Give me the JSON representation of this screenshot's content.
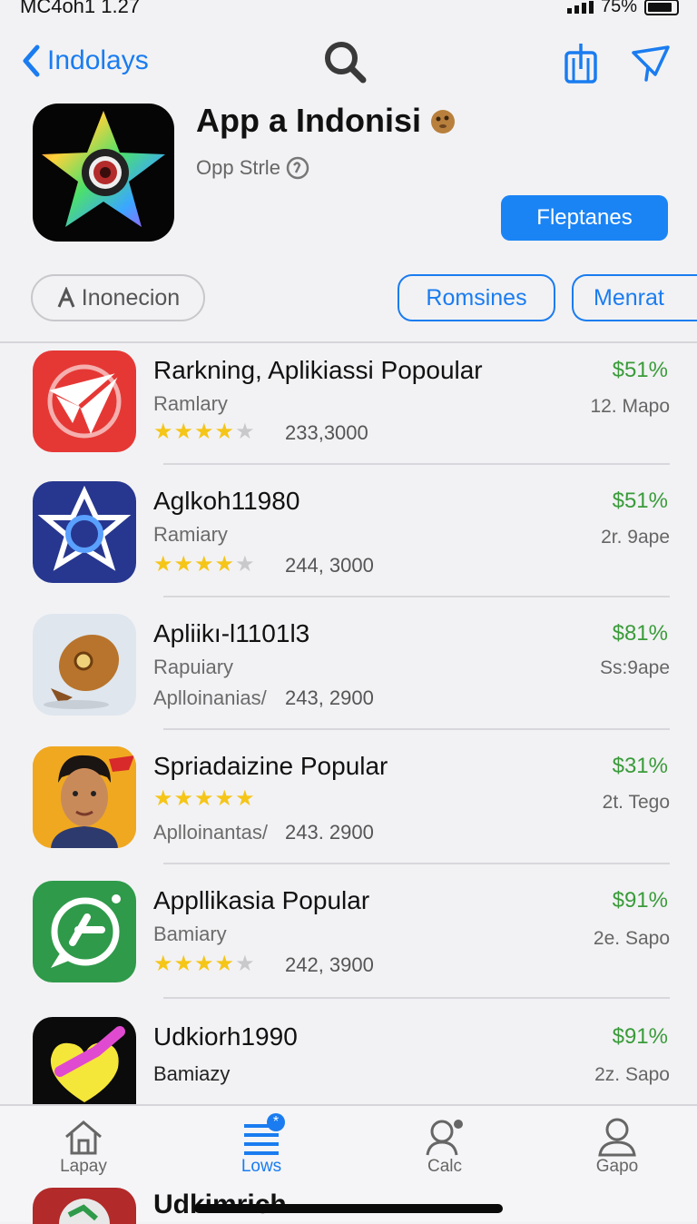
{
  "status": {
    "time": "MC4oh1  1.27",
    "battery": "75%"
  },
  "nav": {
    "back_label": "Indolays"
  },
  "app": {
    "title": "App a Indonisi",
    "subtitle": "Opp Strle",
    "get_label": "Fleptanes"
  },
  "pills": {
    "grey": "Inonecion",
    "blue1": "Romsines",
    "blue2": "Menrat"
  },
  "rows": [
    {
      "name": "Rarkning, Aplikiassi Popoular",
      "category": "Ramlary",
      "rating": 4,
      "count": "233,3000",
      "price": "$51%",
      "size": "12. Mapo"
    },
    {
      "name": "Aglkoh11980",
      "category": "Ramiary",
      "rating": 4,
      "count": "244, 3000",
      "price": "$51%",
      "size": "2r. 9ape"
    },
    {
      "name": "Apliikı-l1101l3",
      "category": "Rapuiary",
      "subtext": "Aplloinanias/",
      "count": "243, 2900",
      "price": "$81%",
      "size": "Ss:9ape"
    },
    {
      "name": "Spriadaizine Popular",
      "rating": 4.5,
      "subtext": "Aplloinantas/",
      "count": "243. 2900",
      "price": "$31%",
      "size": "2t. Tego"
    },
    {
      "name": "Appllikasia Popular",
      "category": "Bamiary",
      "rating": 4,
      "count": "242, 3900",
      "price": "$91%",
      "size": "2e. Sapo"
    },
    {
      "name": "Udkiorh1990",
      "category": "Bamiazy",
      "price": "$91%",
      "size": "2z. Sapo"
    }
  ],
  "peek_text": "Udkimrich",
  "tabs": [
    {
      "label": "Lapay"
    },
    {
      "label": "Lows",
      "badge": "*"
    },
    {
      "label": "Calc"
    },
    {
      "label": "Gapo"
    }
  ],
  "colors": {
    "accent": "#1a7cf0",
    "price_green": "#3a9b3a",
    "star": "#f5c518"
  }
}
